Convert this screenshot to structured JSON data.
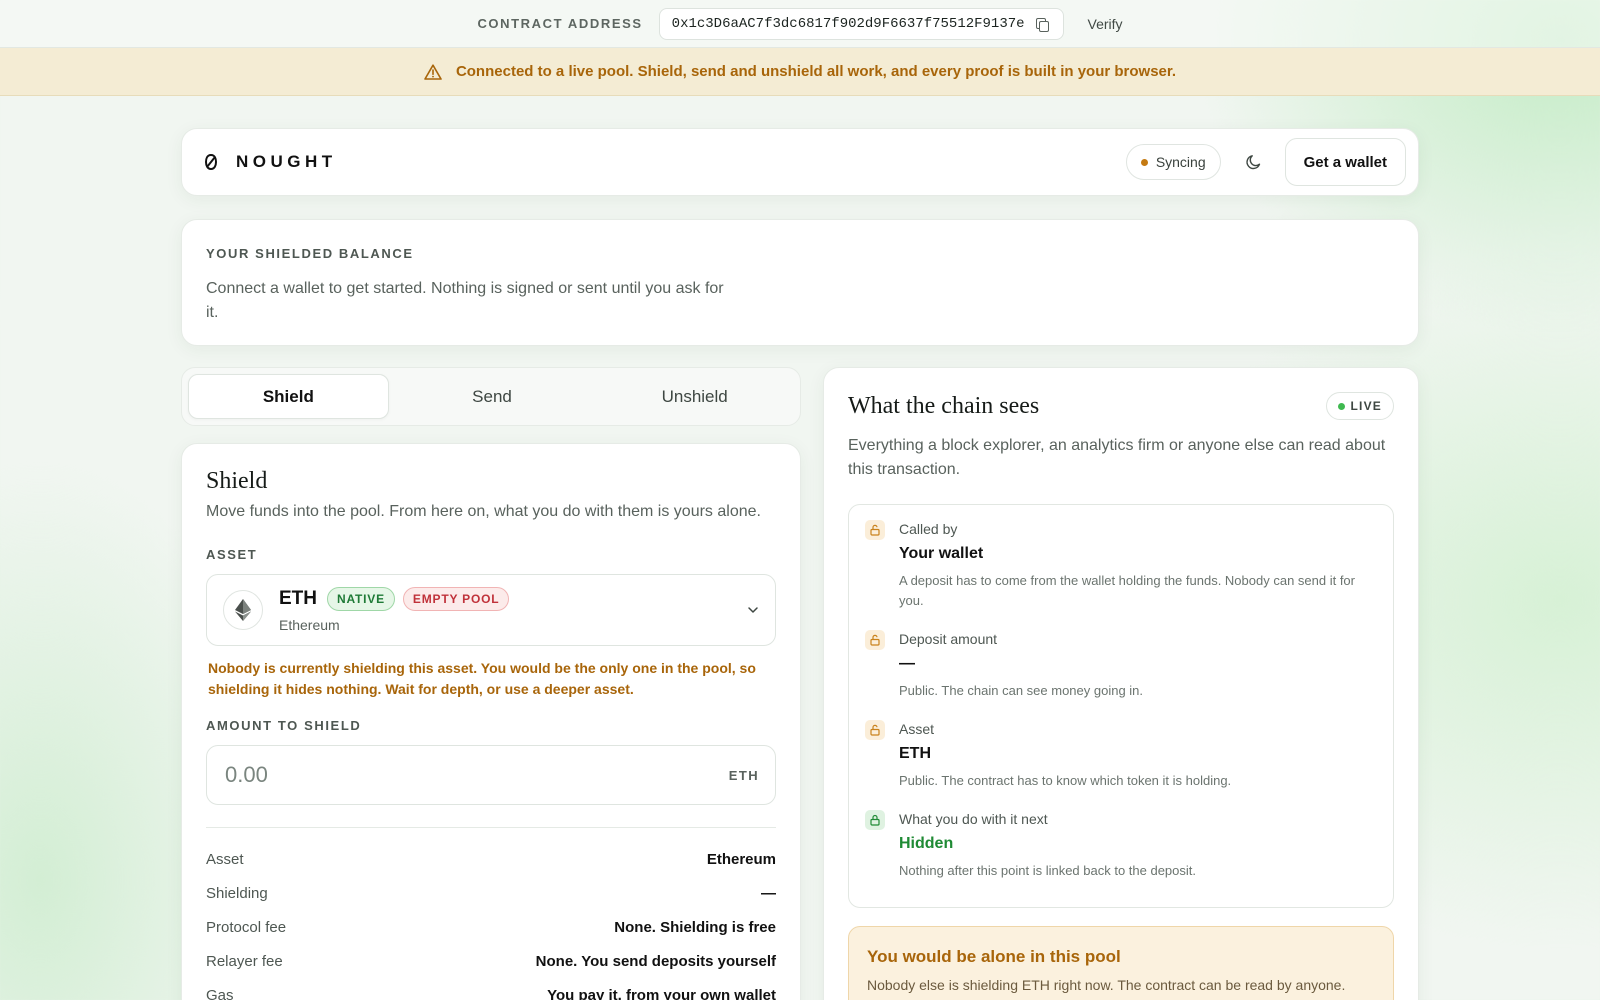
{
  "contract": {
    "label": "CONTRACT ADDRESS",
    "address": "0x1c3D6aAC7f3dc6817f902d9F6637f75512F9137e",
    "verify_label": "Verify"
  },
  "banner": {
    "text": "Connected to a live pool. Shield, send and unshield all work, and every proof is built in your browser."
  },
  "header": {
    "brand": "NOUGHT",
    "sync_status": "Syncing",
    "wallet_button": "Get a wallet"
  },
  "balance": {
    "label": "YOUR SHIELDED BALANCE",
    "message": "Connect a wallet to get started. Nothing is signed or sent until you ask for it."
  },
  "tabs": [
    {
      "label": "Shield",
      "active": true
    },
    {
      "label": "Send",
      "active": false
    },
    {
      "label": "Unshield",
      "active": false
    }
  ],
  "shield": {
    "title": "Shield",
    "subtitle": "Move funds into the pool. From here on, what you do with them is yours alone.",
    "asset_label": "ASSET",
    "asset": {
      "symbol": "ETH",
      "badge_native": "NATIVE",
      "badge_pool": "EMPTY POOL",
      "network": "Ethereum"
    },
    "warning": "Nobody is currently shielding this asset. You would be the only one in the pool, so shielding it hides nothing. Wait for depth, or use a deeper asset.",
    "amount_label": "AMOUNT TO SHIELD",
    "amount_placeholder": "0.00",
    "amount_unit": "ETH",
    "summary": [
      {
        "key": "Asset",
        "value": "Ethereum"
      },
      {
        "key": "Shielding",
        "value": "—"
      },
      {
        "key": "Protocol fee",
        "value": "None. Shielding is free"
      },
      {
        "key": "Relayer fee",
        "value": "None. You send deposits yourself"
      },
      {
        "key": "Gas",
        "value": "You pay it, from your own wallet"
      }
    ]
  },
  "chain": {
    "title": "What the chain sees",
    "live_label": "LIVE",
    "subtitle": "Everything a block explorer, an analytics firm or anyone else can read about this transaction.",
    "facts": [
      {
        "key": "Called by",
        "value": "Your wallet",
        "note": "A deposit has to come from the wallet holding the funds. Nobody can send it for you."
      },
      {
        "key": "Deposit amount",
        "value": "—",
        "note": "Public. The chain can see money going in."
      },
      {
        "key": "Asset",
        "value": "ETH",
        "note": "Public. The contract has to know which token it is holding."
      },
      {
        "key": "What you do with it next",
        "value": "Hidden",
        "note": "Nothing after this point is linked back to the deposit."
      }
    ],
    "alone": {
      "title": "You would be alone in this pool",
      "text": "Nobody else is shielding ETH right now. The contract can be read by anyone."
    }
  },
  "colors": {
    "accent_green": "#1f8a34",
    "warning_amber": "#a8650a",
    "danger_red": "#c0323a",
    "sync_dot": "#c47a12",
    "live_dot": "#3fb950"
  },
  "icons": [
    "copy-icon",
    "warning-icon",
    "logo-icon",
    "moon-icon",
    "ethereum-icon",
    "chevron-down-icon",
    "unlocked-icon",
    "locked-icon"
  ]
}
